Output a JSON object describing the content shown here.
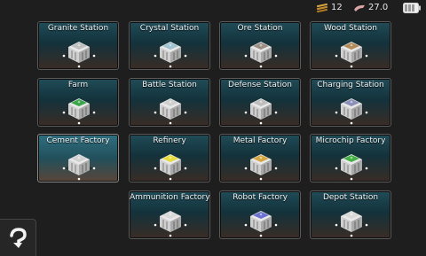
{
  "status": {
    "resource1_value": "12",
    "resource1_icon": "resource-bars-icon",
    "resource2_value": "27.0",
    "resource2_icon": "energy-icon",
    "battery_icon": "battery-icon"
  },
  "stations": [
    {
      "label": "Granite Station",
      "icon": "granite-station-icon",
      "roof": "#bfbfbf"
    },
    {
      "label": "Crystal Station",
      "icon": "crystal-station-icon",
      "roof": "#9fc3cf"
    },
    {
      "label": "Ore Station",
      "icon": "ore-station-icon",
      "roof": "#9b8f84"
    },
    {
      "label": "Wood Station",
      "icon": "wood-station-icon",
      "roof": "#b08a58"
    },
    {
      "label": "Farm",
      "icon": "farm-icon",
      "roof": "#3aa64a"
    },
    {
      "label": "Battle Station",
      "icon": "battle-station-icon",
      "roof": "#cfcfcf"
    },
    {
      "label": "Defense Station",
      "icon": "defense-station-icon",
      "roof": "#bdbdbd"
    },
    {
      "label": "Charging Station",
      "icon": "charging-station-icon",
      "roof": "#8c8fb8"
    },
    {
      "label": "Cement Factory",
      "icon": "cement-factory-icon",
      "roof": "#d0d0d0"
    },
    {
      "label": "Refinery",
      "icon": "refinery-icon",
      "roof": "#e6dc3c"
    },
    {
      "label": "Metal Factory",
      "icon": "metal-factory-icon",
      "roof": "#d4a640"
    },
    {
      "label": "Microchip Factory",
      "icon": "microchip-factory-icon",
      "roof": "#45b045"
    },
    {
      "label": "Ammunition Factory",
      "icon": "ammunition-factory-icon",
      "roof": "#d8d8d8"
    },
    {
      "label": "Robot Factory",
      "icon": "robot-factory-icon",
      "roof": "#6a6fd0"
    },
    {
      "label": "Depot Station",
      "icon": "depot-station-icon",
      "roof": "#d8d8d8"
    }
  ],
  "help_icon": "help-arrow-icon"
}
